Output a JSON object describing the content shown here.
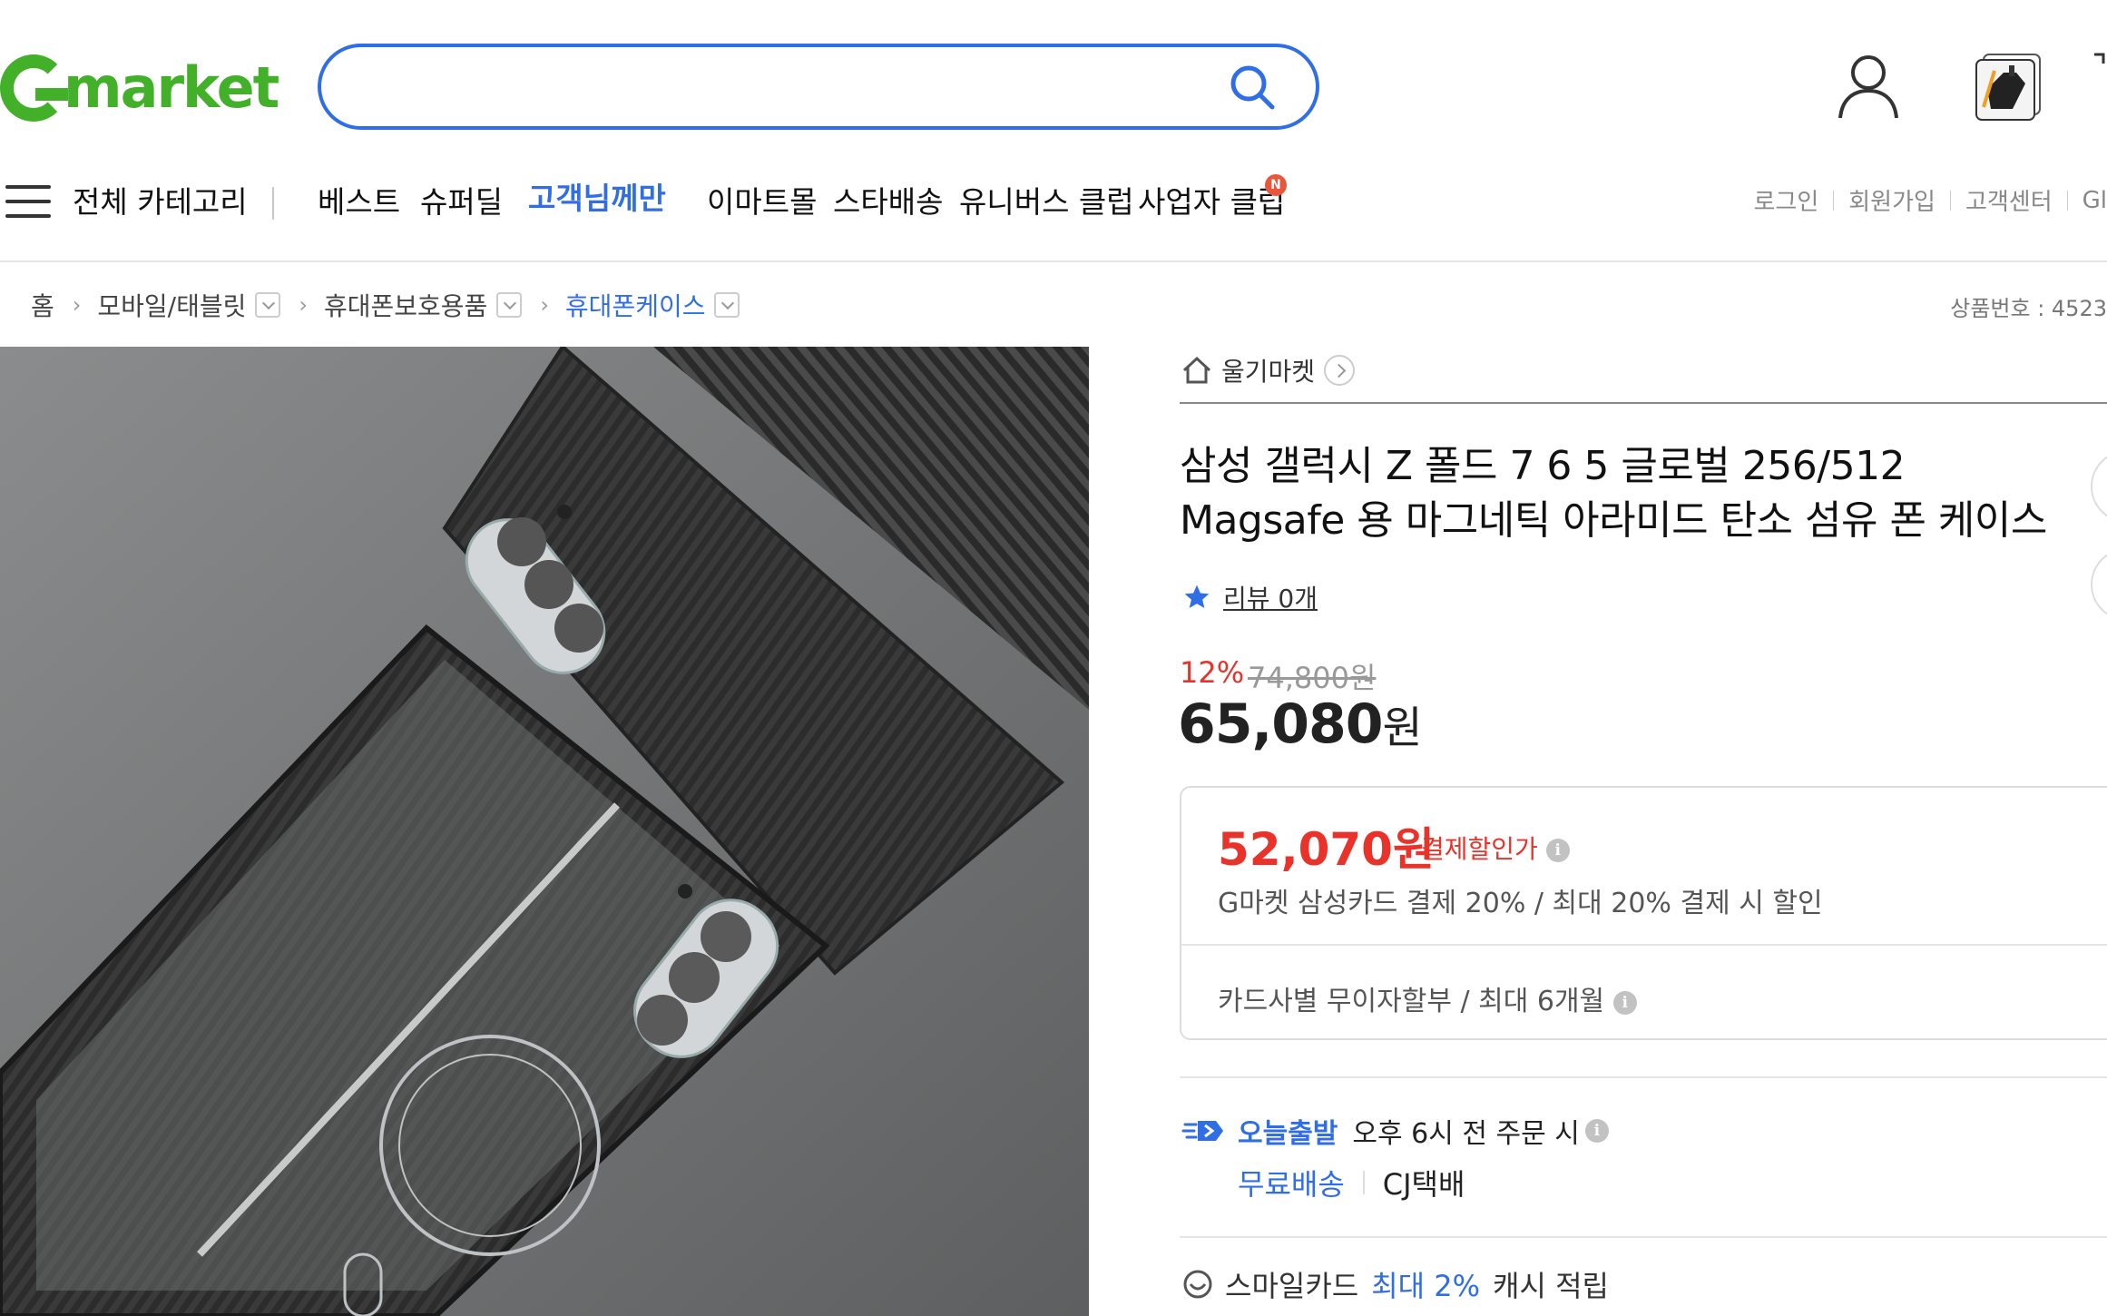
{
  "header": {
    "logo_text": "market",
    "search": {
      "value": "",
      "placeholder": ""
    },
    "icons": [
      "search-icon",
      "user-icon",
      "recent-item-thumbnail"
    ]
  },
  "nav": {
    "all_categories": "전체 카테고리",
    "items": [
      "베스트",
      "슈퍼딜",
      "고객님께만",
      "이마트몰",
      "스타배송",
      "유니버스 클럽",
      "사업자 클럽"
    ],
    "new_badge": "N",
    "util_links": [
      "로그인",
      "회원가입",
      "고객센터",
      "Gl"
    ]
  },
  "breadcrumb": {
    "home": "홈",
    "levels": [
      "모바일/태블릿",
      "휴대폰보호용품",
      "휴대폰케이스"
    ],
    "product_number": "상품번호 : 4523"
  },
  "product": {
    "store_name": "울기마켓",
    "title_line1": "삼성 갤럭시 Z 폴드 7 6 5 글로벌 256/512",
    "title_line2": "Magsafe 용 마그네틱 아라미드 탄소 섬유 폰 케이스",
    "review_label": "리뷰 0개",
    "discount_rate": "12%",
    "original_price": "74,800원",
    "price_number": "65,080",
    "price_unit": "원"
  },
  "card_benefit": {
    "price": "52,070원",
    "price_tag": "결제할인가",
    "description": "G마켓 삼성카드 결제 20% / 최대 20% 결제 시 할인",
    "installment": "카드사별 무이자할부 / 최대 6개월",
    "info_glyph": "i"
  },
  "shipping": {
    "brand": "오늘출발",
    "cutoff": "오후 6시 전 주문 시",
    "free": "무료배송",
    "carrier": "CJ택배"
  },
  "smile_card": {
    "prefix": "스마일카드",
    "highlight": "최대 2%",
    "suffix": "캐시 적립"
  },
  "colors": {
    "brand_green": "#43b02a",
    "accent_blue": "#2f6ee6",
    "sale_red": "#e8322a"
  }
}
